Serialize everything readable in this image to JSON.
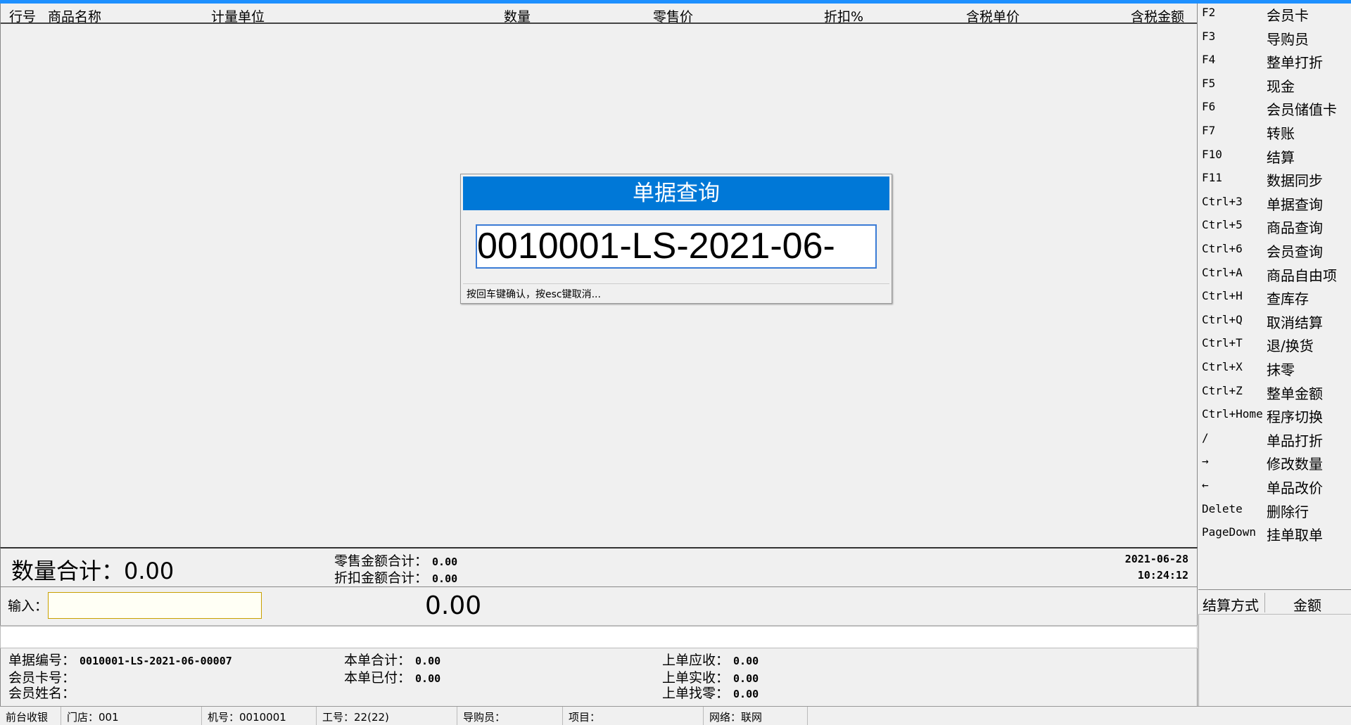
{
  "grid": {
    "columns": [
      "行号",
      "商品名称",
      "计量单位",
      "数量",
      "零售价",
      "折扣%",
      "含税单价",
      "含税金额"
    ]
  },
  "shortcuts": [
    {
      "key": "F2",
      "label": "会员卡"
    },
    {
      "key": "F3",
      "label": "导购员"
    },
    {
      "key": "F4",
      "label": "整单打折"
    },
    {
      "key": "F5",
      "label": "现金"
    },
    {
      "key": "F6",
      "label": "会员储值卡"
    },
    {
      "key": "F7",
      "label": "转账"
    },
    {
      "key": "F10",
      "label": "结算"
    },
    {
      "key": "F11",
      "label": "数据同步"
    },
    {
      "key": "Ctrl+3",
      "label": "单据查询"
    },
    {
      "key": "Ctrl+5",
      "label": "商品查询"
    },
    {
      "key": "Ctrl+6",
      "label": "会员查询"
    },
    {
      "key": "Ctrl+A",
      "label": "商品自由项"
    },
    {
      "key": "Ctrl+H",
      "label": "查库存"
    },
    {
      "key": "Ctrl+Q",
      "label": "取消结算"
    },
    {
      "key": "Ctrl+T",
      "label": "退/换货"
    },
    {
      "key": "Ctrl+X",
      "label": "抹零"
    },
    {
      "key": "Ctrl+Z",
      "label": "整单金额"
    },
    {
      "key": "Ctrl+Home",
      "label": "程序切换"
    },
    {
      "key": "/",
      "label": "单品打折"
    },
    {
      "key": "→",
      "label": "修改数量"
    },
    {
      "key": "←",
      "label": "单品改价"
    },
    {
      "key": "Delete",
      "label": "删除行"
    },
    {
      "key": "PageDown",
      "label": "挂单取单"
    }
  ],
  "payment": {
    "method_header": "结算方式",
    "amount_header": "金额"
  },
  "totals": {
    "qty_total": "数量合计：0.00",
    "retail_label": "零售金额合计：",
    "retail_value": "0.00",
    "discount_label": "折扣金额合计：",
    "discount_value": "0.00",
    "date": "2021-06-28",
    "time": "10:24:12"
  },
  "input": {
    "label": "输入：",
    "value": "",
    "amount": "0.00"
  },
  "bill": {
    "number_label": "单据编号：",
    "number_value": "0010001-LS-2021-06-00007",
    "card_label": "会员卡号：",
    "name_label": "会员姓名：",
    "total_label": "本单合计：",
    "total_value": "0.00",
    "paid_label": "本单已付：",
    "paid_value": "0.00",
    "prev_due_label": "上单应收：",
    "prev_due_value": "0.00",
    "prev_received_label": "上单实收：",
    "prev_received_value": "0.00",
    "prev_change_label": "上单找零：",
    "prev_change_value": "0.00"
  },
  "statusbar": {
    "mode": "前台收银",
    "store": "门店：001",
    "machine": "机号：0010001",
    "worker": "工号：22(22)",
    "guide": "导购员：",
    "project": "项目：",
    "network": "网络：联网"
  },
  "modal": {
    "title": "单据查询",
    "input_value": "0010001-LS-2021-06-",
    "hint": "按回车键确认，按esc键取消..."
  }
}
